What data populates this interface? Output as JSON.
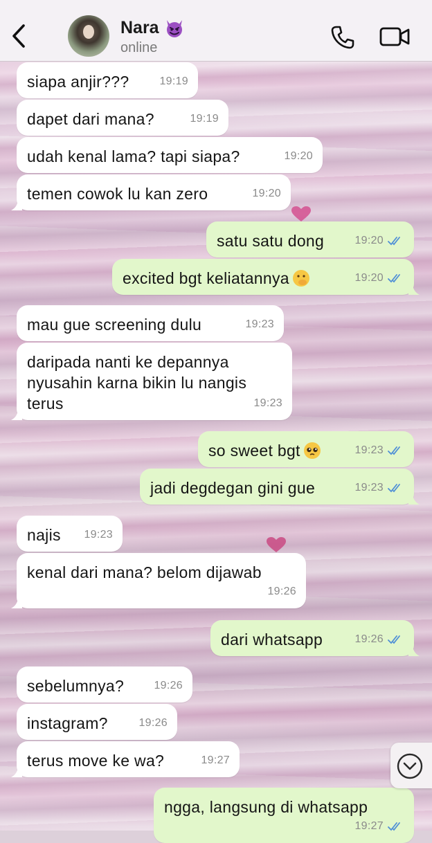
{
  "header": {
    "contact_name": "Nara",
    "status": "online",
    "name_emoji_icon": "smiling-devil-emoji",
    "back_icon": "chevron-left-icon",
    "call_icon": "phone-icon",
    "video_icon": "video-camera-icon"
  },
  "colors": {
    "incoming_bubble": "#ffffff",
    "outgoing_bubble": "#e2f7cb",
    "read_ticks": "#4f8fd6"
  },
  "messages": [
    {
      "dir": "in",
      "text": "siapa anjir???",
      "time": "19:19"
    },
    {
      "dir": "in",
      "text": "dapet dari mana?",
      "time": "19:19"
    },
    {
      "dir": "in",
      "text": "udah kenal lama? tapi siapa?",
      "time": "19:20"
    },
    {
      "dir": "in",
      "text": "temen cowok lu kan zero",
      "time": "19:20"
    },
    {
      "dir": "out",
      "text": "satu satu dong",
      "time": "19:20"
    },
    {
      "dir": "out",
      "text": "excited bgt keliatannya",
      "time": "19:20",
      "emoji": "face-with-hand-over-mouth"
    },
    {
      "dir": "in",
      "text": "mau gue screening dulu",
      "time": "19:23"
    },
    {
      "dir": "in",
      "text": "daripada nanti ke depannya\nnyusahin karna bikin lu nangis\nterus",
      "time": "19:23"
    },
    {
      "dir": "out",
      "text": "so sweet bgt",
      "time": "19:23",
      "emoji": "pleading-face"
    },
    {
      "dir": "out",
      "text": "jadi degdegan gini gue",
      "time": "19:23"
    },
    {
      "dir": "in",
      "text": "najis",
      "time": "19:23"
    },
    {
      "dir": "in",
      "text": "kenal dari mana? belom dijawab",
      "time": "19:26"
    },
    {
      "dir": "out",
      "text": "dari whatsapp",
      "time": "19:26"
    },
    {
      "dir": "in",
      "text": "sebelumnya?",
      "time": "19:26"
    },
    {
      "dir": "in",
      "text": "instagram?",
      "time": "19:26"
    },
    {
      "dir": "in",
      "text": "terus move ke wa?",
      "time": "19:27"
    },
    {
      "dir": "out",
      "text": "ngga, langsung di whatsapp",
      "time": "19:27"
    }
  ],
  "scroll_button_icon": "chevron-down-circle-icon"
}
